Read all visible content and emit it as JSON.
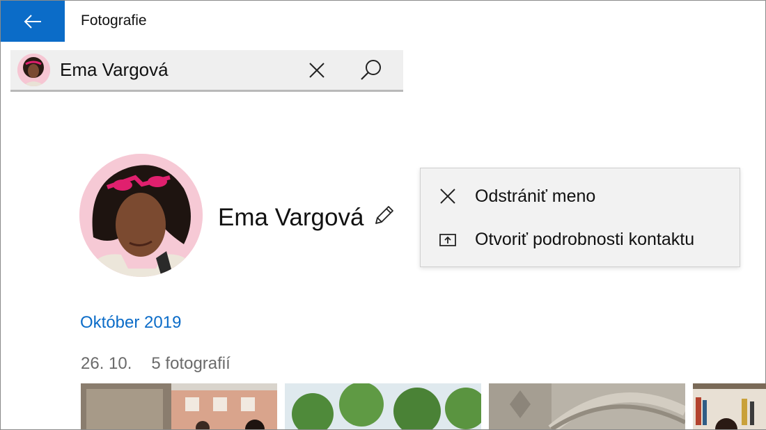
{
  "app": {
    "title": "Fotografie"
  },
  "search": {
    "query": "Ema Vargová"
  },
  "profile": {
    "name": "Ema Vargová"
  },
  "context_menu": {
    "items": [
      {
        "label": "Odstrániť meno",
        "icon": "close-icon"
      },
      {
        "label": "Otvoriť podrobnosti kontaktu",
        "icon": "open-contact-icon"
      }
    ]
  },
  "timeline": {
    "month": "Október 2019",
    "date": "26. 10.",
    "count": "5 fotografií"
  },
  "colors": {
    "accent": "#0b6cc8",
    "menu_bg": "#f2f2f2",
    "search_bg": "#efefef"
  }
}
